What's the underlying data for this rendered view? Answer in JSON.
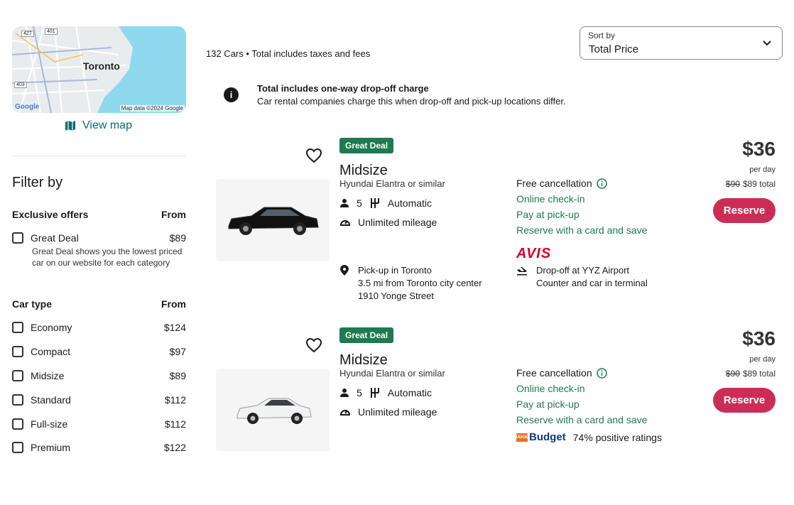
{
  "sidebar": {
    "map": {
      "city_label": "Toronto",
      "google_label": "Google",
      "credit": "Map data ©2024 Google",
      "road_labels": [
        "427",
        "401",
        "403"
      ]
    },
    "view_map_label": "View map",
    "filter_title": "Filter by",
    "exclusive": {
      "heading": "Exclusive offers",
      "from_label": "From",
      "items": [
        {
          "label": "Great Deal",
          "price": "$89",
          "description": "Great Deal shows you the lowest priced car on our website for each category"
        }
      ]
    },
    "car_type": {
      "heading": "Car type",
      "from_label": "From",
      "items": [
        {
          "label": "Economy",
          "price": "$124"
        },
        {
          "label": "Compact",
          "price": "$97"
        },
        {
          "label": "Midsize",
          "price": "$89"
        },
        {
          "label": "Standard",
          "price": "$112"
        },
        {
          "label": "Full-size",
          "price": "$112"
        },
        {
          "label": "Premium",
          "price": "$122"
        }
      ]
    }
  },
  "main": {
    "results_count": "132 Cars • Total includes taxes and fees",
    "sort": {
      "label": "Sort by",
      "value": "Total Price"
    },
    "notice": {
      "title": "Total includes one-way drop-off charge",
      "body": "Car rental companies charge this when drop-off and pick-up locations differ."
    },
    "cards": [
      {
        "badge": "Great Deal",
        "title": "Midsize",
        "subtitle": "Hyundai Elantra or similar",
        "seats": "5",
        "transmission": "Automatic",
        "mileage": "Unlimited mileage",
        "cancellation": "Free cancellation",
        "features": [
          "Online check-in",
          "Pay at pick-up",
          "Reserve with a card and save"
        ],
        "vendor": "AVIS",
        "pickup": {
          "title": "Pick-up in Toronto",
          "line2": "3.5 mi from Toronto city center",
          "line3": "1910 Yonge Street"
        },
        "dropoff": {
          "title": "Drop-off at YYZ Airport",
          "line2": "Counter and car in terminal"
        },
        "price": "$36",
        "per_day": "per day",
        "old_total": "$90",
        "total": "$89 total",
        "reserve_label": "Reserve",
        "car_color": "#111111"
      },
      {
        "badge": "Great Deal",
        "title": "Midsize",
        "subtitle": "Hyundai Elantra or similar",
        "seats": "5",
        "transmission": "Automatic",
        "mileage": "Unlimited mileage",
        "cancellation": "Free cancellation",
        "features": [
          "Online check-in",
          "Pay at pick-up",
          "Reserve with a card and save"
        ],
        "vendor": "Budget",
        "vendor_mark": "BUDGET",
        "rating_text": "74% positive ratings",
        "price": "$36",
        "per_day": "per day",
        "old_total": "$90",
        "total": "$89 total",
        "reserve_label": "Reserve",
        "car_color": "#f2f2f2"
      }
    ]
  },
  "colors": {
    "green": "#1e7a4f",
    "reserve": "#cc2d57",
    "teal_link": "#0b6b6f",
    "avis_red": "#d4002a"
  }
}
